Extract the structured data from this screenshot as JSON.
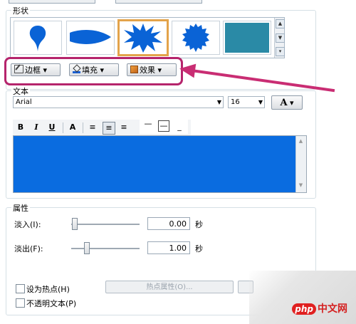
{
  "shape_group": {
    "title": "形状",
    "scroll_up": "▲",
    "scroll_down": "▼",
    "scroll_more": "▾"
  },
  "shape_buttons": [
    {
      "label": "边框"
    },
    {
      "label": "填充"
    },
    {
      "label": "效果"
    }
  ],
  "text_group": {
    "title": "文本",
    "font": "Arial",
    "size": "16",
    "size_label": "A",
    "format_buttons": [
      "B",
      "I",
      "U",
      "A"
    ],
    "align_buttons": [
      "≡",
      "≡",
      "≡"
    ],
    "valign_buttons": [
      "—",
      "—",
      "_"
    ]
  },
  "properties": {
    "title": "属性",
    "fade_in_label": "淡入(I):",
    "fade_in_value": "0.00",
    "fade_in_unit": "秒",
    "fade_out_label": "淡出(F):",
    "fade_out_value": "1.00",
    "fade_out_unit": "秒",
    "hotspot_label": "设为热点(H)",
    "hotspot_props_button": "热点属性(O)...",
    "opaque_text_label": "不透明文本(P)"
  },
  "colors": {
    "shape_blue": "#0a63d6",
    "highlight": "#b5246c",
    "editor_bg": "#0a6ce0",
    "thumb_selected": "#e3a34a"
  },
  "watermark": "php中文网"
}
